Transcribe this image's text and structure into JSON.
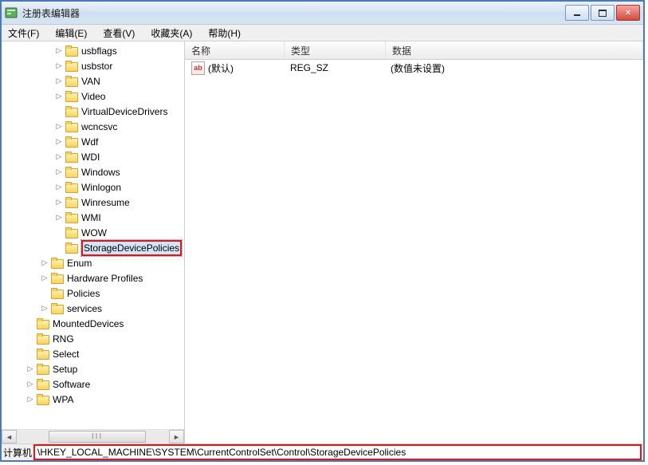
{
  "window": {
    "title": "注册表编辑器"
  },
  "menu": {
    "file": "文件(F)",
    "edit": "编辑(E)",
    "view": "查看(V)",
    "favorites": "收藏夹(A)",
    "help": "帮助(H)"
  },
  "tree": {
    "items": [
      {
        "depth": 3,
        "exp": "▷",
        "label": "usbflags"
      },
      {
        "depth": 3,
        "exp": "▷",
        "label": "usbstor"
      },
      {
        "depth": 3,
        "exp": "▷",
        "label": "VAN"
      },
      {
        "depth": 3,
        "exp": "▷",
        "label": "Video"
      },
      {
        "depth": 3,
        "exp": "",
        "label": "VirtualDeviceDrivers"
      },
      {
        "depth": 3,
        "exp": "▷",
        "label": "wcncsvc"
      },
      {
        "depth": 3,
        "exp": "▷",
        "label": "Wdf"
      },
      {
        "depth": 3,
        "exp": "▷",
        "label": "WDI"
      },
      {
        "depth": 3,
        "exp": "▷",
        "label": "Windows"
      },
      {
        "depth": 3,
        "exp": "▷",
        "label": "Winlogon"
      },
      {
        "depth": 3,
        "exp": "▷",
        "label": "Winresume"
      },
      {
        "depth": 3,
        "exp": "▷",
        "label": "WMI"
      },
      {
        "depth": 3,
        "exp": "",
        "label": "WOW"
      },
      {
        "depth": 3,
        "exp": "",
        "label": "StorageDevicePolicies",
        "highlight": true,
        "selected": true
      },
      {
        "depth": 2,
        "exp": "▷",
        "label": "Enum"
      },
      {
        "depth": 2,
        "exp": "▷",
        "label": "Hardware Profiles"
      },
      {
        "depth": 2,
        "exp": "",
        "label": "Policies"
      },
      {
        "depth": 2,
        "exp": "▷",
        "label": "services"
      },
      {
        "depth": 1,
        "exp": "",
        "label": "MountedDevices"
      },
      {
        "depth": 1,
        "exp": "",
        "label": "RNG"
      },
      {
        "depth": 1,
        "exp": "",
        "label": "Select"
      },
      {
        "depth": 1,
        "exp": "▷",
        "label": "Setup"
      },
      {
        "depth": 1,
        "exp": "▷",
        "label": "Software"
      },
      {
        "depth": 1,
        "exp": "▷",
        "label": "WPA"
      }
    ]
  },
  "columns": {
    "name": "名称",
    "type": "类型",
    "data": "数据"
  },
  "values": [
    {
      "icon_text": "ab",
      "name": "(默认)",
      "type": "REG_SZ",
      "data": "(数值未设置)"
    }
  ],
  "status": {
    "label": "计算机",
    "path": "\\HKEY_LOCAL_MACHINE\\SYSTEM\\CurrentControlSet\\Control\\StorageDevicePolicies"
  },
  "scrollbar": {
    "thumb_label": "III"
  }
}
